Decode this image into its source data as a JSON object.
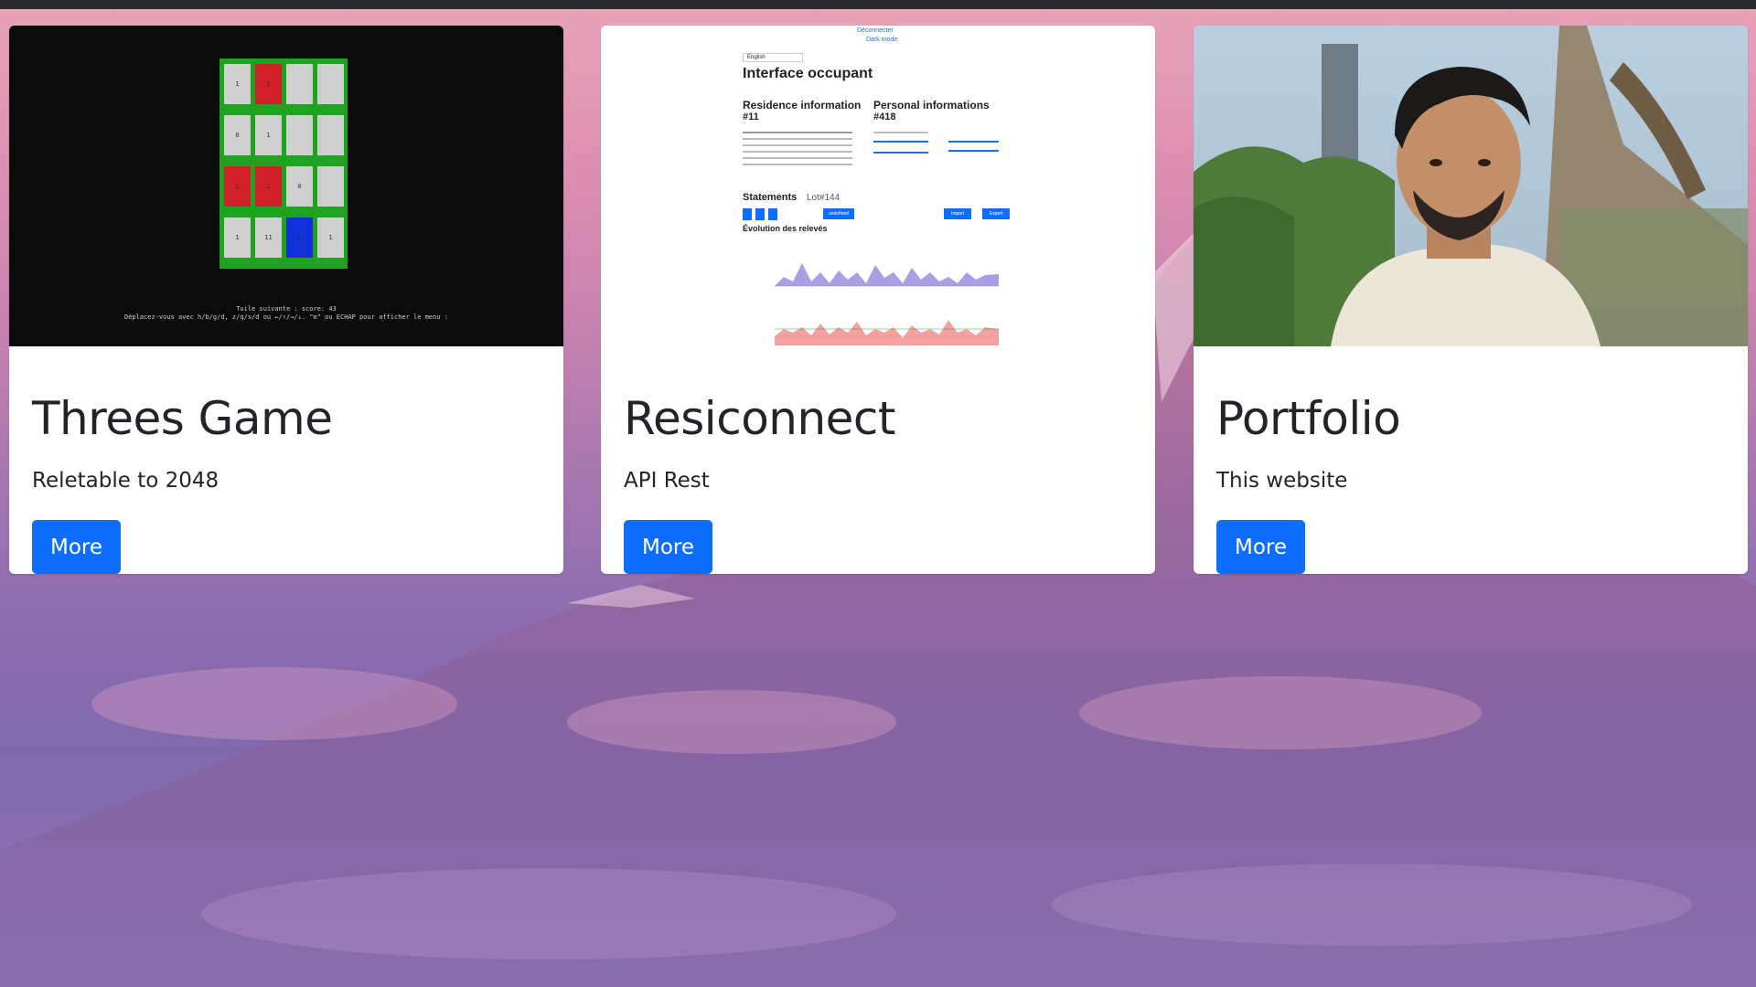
{
  "cards": [
    {
      "title": "Threes Game",
      "subtitle": "Reletable to 2048",
      "button_label": "More",
      "thumbnail": {
        "tiles": [
          "1",
          "1",
          "",
          "",
          "0",
          "1",
          "",
          "",
          "2",
          "2",
          "0",
          "",
          "1",
          "11",
          "1",
          "1"
        ],
        "tile_colors": [
          "#cfcfcf",
          "#d1202a",
          "#cfcfcf",
          "#cfcfcf",
          "#cfcfcf",
          "#cfcfcf",
          "#cfcfcf",
          "#cfcfcf",
          "#d1202a",
          "#d1202a",
          "#cfcfcf",
          "#cfcfcf",
          "#cfcfcf",
          "#cfcfcf",
          "#1030d8",
          "#cfcfcf"
        ],
        "line1": "Tuile suivante :      score: 43",
        "line2": "Déplacez-vous avec h/b/g/d, z/q/s/d ou ←/↑/→/↓. \"m\" ou ECHAP pour afficher le menu :"
      }
    },
    {
      "title": "Resiconnect",
      "subtitle": "API Rest",
      "button_label": "More",
      "thumbnail": {
        "top_link1": "Déconnecter",
        "top_link2": "Dark mode",
        "lang": "English",
        "heading": "Interface occupant",
        "res_title": "Residence information",
        "res_id": "#11",
        "pers_title": "Personal informations",
        "pers_id": "#418",
        "statements": "Statements",
        "lot": "Lot#144",
        "evolution": "Évolution des relevés",
        "btn_undefined": "undefined",
        "btn_import": "Import",
        "btn_export": "Export"
      }
    },
    {
      "title": "Portfolio",
      "subtitle": "This website",
      "button_label": "More",
      "thumbnail": {}
    }
  ],
  "colors": {
    "accent": "#0d6efd",
    "game_bg": "#0b0b0b",
    "board_green": "#1fa21f"
  }
}
